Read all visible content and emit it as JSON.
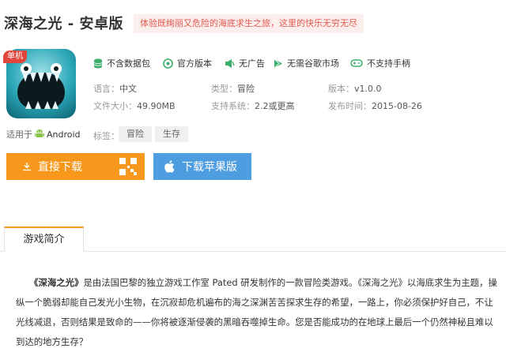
{
  "header": {
    "title": "深海之光 - 安卓版",
    "slogan": "体验既绚丽又危险的海底求生之旅，这里的快乐无穷无尽"
  },
  "app": {
    "icon_name": "deep-sea-creature-icon",
    "ribbon": "单机",
    "suitable_label": "适用于",
    "platform": "Android"
  },
  "features": [
    {
      "icon": "database-icon",
      "label": "不含数据包"
    },
    {
      "icon": "package-icon",
      "label": "官方版本"
    },
    {
      "icon": "no-ads-icon",
      "label": "无广告"
    },
    {
      "icon": "play-store-icon",
      "label": "无需谷歌市场"
    },
    {
      "icon": "gamepad-icon",
      "label": "不支持手柄"
    }
  ],
  "info": {
    "language_key": "语言：",
    "language": "中文",
    "type_key": "类型：",
    "type": "冒险",
    "version_key": "版本：",
    "version": "v1.0.0",
    "size_key": "文件大小：",
    "size": "49.90MB",
    "system_key": "支持系统：",
    "system": "2.2或更高",
    "date_key": "发布时间：",
    "date": "2015-08-26",
    "tags_key": "标签：",
    "tags": [
      "冒险",
      "生存"
    ]
  },
  "buttons": {
    "direct_download": "直接下载",
    "apple_download": "下载苹果版"
  },
  "section": {
    "tab": "游戏简介"
  },
  "description": {
    "game_name": "《深海之光》",
    "part1": "是由法国巴黎的独立游戏工作室 Pated 研发制作的一款冒险类游戏。《深海之光》以海底求生为主题，操纵一个脆弱却能自己发光小生物，在沉寂却危机遍布的海之深渊苦苦探求生存的希望，一路上，你必须保护好自己，不让光线减退，否则结果是致命的——你将被逐渐侵袭的黑暗吞噬掉生命。您是否能成功的在地球上最后一个仍然神秘且难以到达的地方生存？"
  },
  "colors": {
    "orange": "#f7981d",
    "blue": "#4e9de0",
    "green_icon": "#3aae6a",
    "slogan_bg": "#fdeeee",
    "slogan_text": "#e05a4e"
  }
}
